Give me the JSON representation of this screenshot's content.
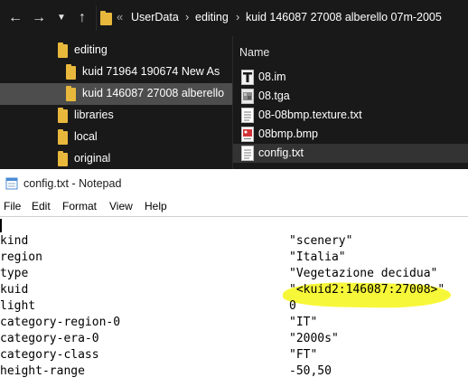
{
  "explorer": {
    "address": {
      "overflow": "«",
      "crumbs": [
        "UserData",
        "editing",
        "kuid 146087 27008 alberello 07m-2005"
      ]
    },
    "nav_items": [
      {
        "label": "editing"
      },
      {
        "label": "kuid 71964 190674 New As"
      },
      {
        "label": "kuid 146087 27008 alberello"
      },
      {
        "label": "libraries"
      },
      {
        "label": "local"
      },
      {
        "label": "original"
      }
    ],
    "column_header": "Name",
    "files": [
      {
        "name": "08.im",
        "icon": "im-file-icon"
      },
      {
        "name": "08.tga",
        "icon": "image-file-icon"
      },
      {
        "name": "08-08bmp.texture.txt",
        "icon": "text-file-icon"
      },
      {
        "name": "08bmp.bmp",
        "icon": "bitmap-file-icon"
      },
      {
        "name": "config.txt",
        "icon": "text-file-icon"
      }
    ],
    "colors": {
      "background": "#191919",
      "folder": "#e8b83d",
      "selected": "#4d4d4d"
    }
  },
  "notepad": {
    "title": "config.txt - Notepad",
    "menu": [
      "File",
      "Edit",
      "Format",
      "View",
      "Help"
    ],
    "lines": [
      {
        "key": "kind",
        "value": "\"scenery\""
      },
      {
        "key": "region",
        "value": "\"Italia\""
      },
      {
        "key": "type",
        "value": "\"Vegetazione decidua\""
      },
      {
        "key": "kuid",
        "value": "\"<kuid2:146087:27008>\""
      },
      {
        "key": "light",
        "value": "0"
      },
      {
        "key": "category-region-0",
        "value": "\"IT\""
      },
      {
        "key": "category-era-0",
        "value": "\"2000s\""
      },
      {
        "key": "category-class",
        "value": "\"FT\""
      },
      {
        "key": "height-range",
        "value": "-50,50"
      }
    ],
    "highlight_color": "#f7f73a"
  }
}
